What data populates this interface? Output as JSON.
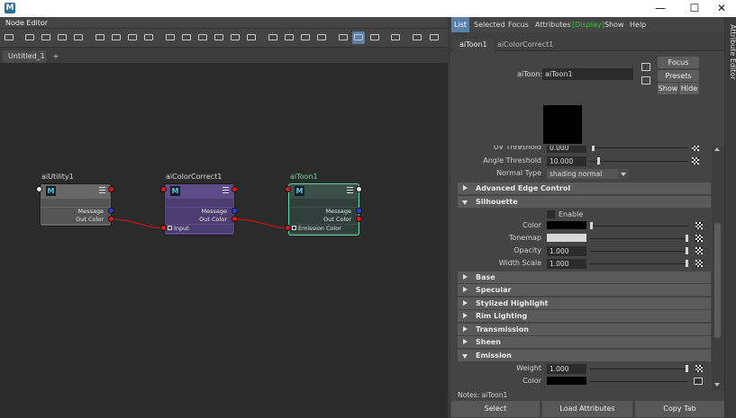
{
  "app": {
    "icon_label": "M",
    "window_controls": {
      "minimize": "—",
      "maximize": "☐",
      "close": "✕"
    }
  },
  "node_editor": {
    "panel_title": "Node Editor",
    "tab_name": "Untitled_1",
    "add_tab": "+",
    "nodes": [
      {
        "title": "aiUtility1",
        "icon": "M",
        "ports": [
          "Message",
          "Out Color"
        ]
      },
      {
        "title": "aiColorCorrect1",
        "icon": "M",
        "ports": [
          "Message",
          "Out Color"
        ],
        "input": "Input"
      },
      {
        "title": "aiToon1",
        "icon": "M",
        "ports": [
          "Message",
          "Out Color"
        ],
        "input": "Emission Color"
      }
    ]
  },
  "attr_editor": {
    "side_label": "Attribute Editor",
    "menu": [
      "List",
      "Selected",
      "Focus",
      "Attributes",
      "[Display]",
      "Show",
      "Help"
    ],
    "tabs": [
      "aiToon1",
      "aiColorCorrect1"
    ],
    "node_label": "aiToon:",
    "node_name": "aiToon1",
    "buttons": {
      "focus": "Focus",
      "presets": "Presets",
      "show": "Show",
      "hide": "Hide"
    },
    "partial_row": {
      "label": "UV Threshold",
      "value": "0.000"
    },
    "angle_threshold": {
      "label": "Angle Threshold",
      "value": "10.000"
    },
    "normal_type": {
      "label": "Normal Type",
      "value": "shading normal"
    },
    "section_advanced_edge": "Advanced Edge Control",
    "section_silhouette": "Silhouette",
    "silhouette": {
      "enable": "Enable",
      "color_label": "Color",
      "tonemap_label": "Tonemap",
      "opacity_label": "Opacity",
      "opacity_value": "1.000",
      "width_label": "Width Scale",
      "width_value": "1.000"
    },
    "collapsed_sections": [
      "Base",
      "Specular",
      "Stylized Highlight",
      "Rim Lighting",
      "Transmission",
      "Sheen"
    ],
    "section_emission": "Emission",
    "emission": {
      "weight_label": "Weight",
      "weight_value": "1.000",
      "color_label": "Color"
    },
    "notes_label": "Notes: aiToon1",
    "bottom_buttons": {
      "select": "Select",
      "load": "Load Attributes",
      "copy": "Copy Tab"
    }
  },
  "colors": {
    "display_green": "#21d321",
    "list_highlight": "#5b7fa6",
    "toon_node": "#3b4e48",
    "cc_node": "#5d4b8a",
    "connection": "#c81414",
    "selected_outline": "#62d6a3"
  }
}
